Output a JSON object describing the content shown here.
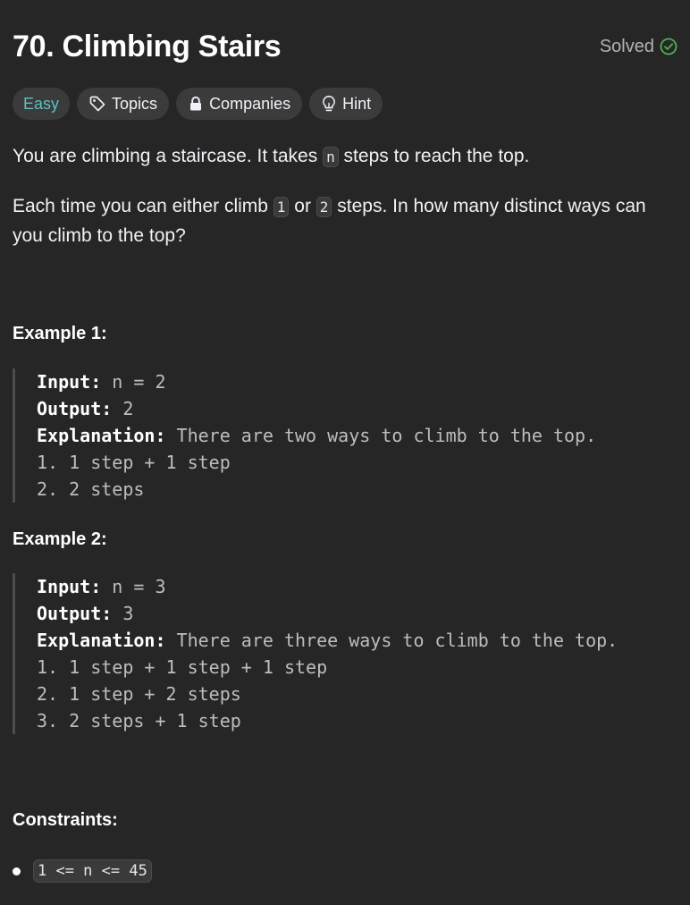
{
  "title": "70. Climbing Stairs",
  "status": {
    "label": "Solved",
    "icon": "check-circle-icon",
    "color": "#4fb14f"
  },
  "tags": [
    {
      "label": "Easy",
      "color": "#5dbfc0"
    },
    {
      "label": "Topics",
      "icon": "tag-icon"
    },
    {
      "label": "Companies",
      "icon": "lock-icon"
    },
    {
      "label": "Hint",
      "icon": "lightbulb-icon"
    }
  ],
  "description": {
    "p1_a": "You are climbing a staircase. It takes ",
    "p1_code": "n",
    "p1_b": " steps to reach the top.",
    "p2_a": "Each time you can either climb ",
    "p2_code1": "1",
    "p2_b": " or ",
    "p2_code2": "2",
    "p2_c": " steps. In how many distinct ways can you climb to the top?"
  },
  "examples": [
    {
      "heading": "Example 1:",
      "input_label": "Input:",
      "input_value": " n = 2",
      "output_label": "Output:",
      "output_value": " 2",
      "explanation_label": "Explanation:",
      "explanation_value": " There are two ways to climb to the top.",
      "steps": [
        "1. 1 step + 1 step",
        "2. 2 steps"
      ]
    },
    {
      "heading": "Example 2:",
      "input_label": "Input:",
      "input_value": " n = 3",
      "output_label": "Output:",
      "output_value": " 3",
      "explanation_label": "Explanation:",
      "explanation_value": " There are three ways to climb to the top.",
      "steps": [
        "1. 1 step + 1 step + 1 step",
        "2. 1 step + 2 steps",
        "3. 2 steps + 1 step"
      ]
    }
  ],
  "constraints": {
    "heading": "Constraints:",
    "items": [
      "1 <= n <= 45"
    ]
  }
}
